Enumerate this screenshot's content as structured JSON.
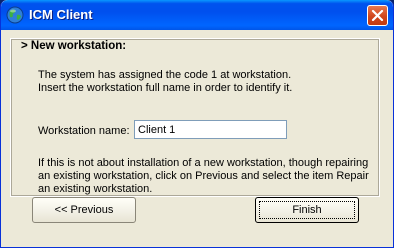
{
  "window": {
    "title": "ICM Client"
  },
  "group": {
    "legend": "> New workstation:"
  },
  "messages": {
    "line1": "The system has assigned the code 1 at workstation.",
    "line2": "Insert the workstation full name in order to identify it.",
    "info": "If this is not about installation of a new workstation, though repairing an existing workstation, click on Previous and select the item Repair an existing workstation."
  },
  "form": {
    "workstation_label": "Workstation name:",
    "workstation_value": "Client 1"
  },
  "buttons": {
    "previous": "<< Previous",
    "finish": "Finish"
  },
  "icons": {
    "app": "globe-icon",
    "close": "close-icon"
  },
  "colors": {
    "titlebar": "#0054e3",
    "close_button": "#d0461d",
    "dialog_background": "#ece9d8"
  }
}
